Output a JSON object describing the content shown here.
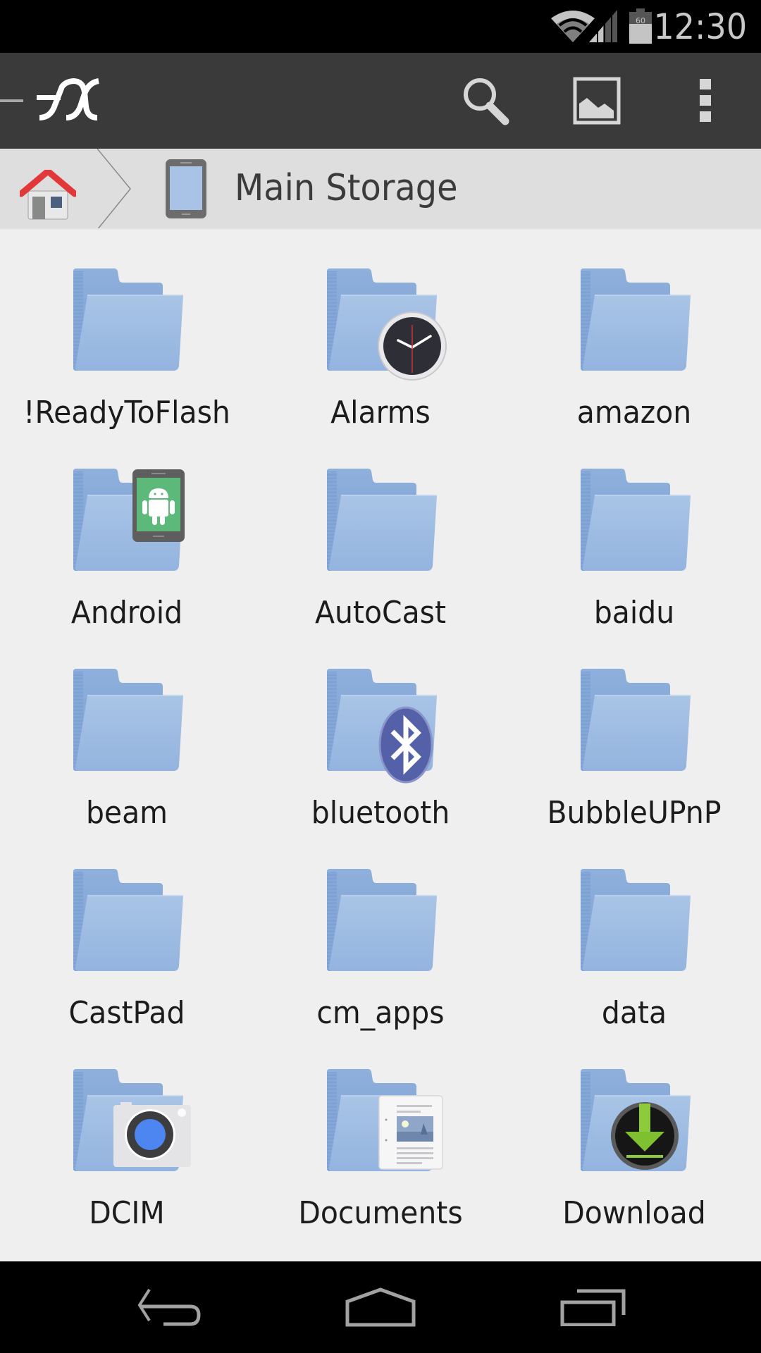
{
  "status_bar": {
    "time": "12:30",
    "battery_level": "60",
    "icons": [
      "wifi-icon",
      "cell-signal-icon",
      "battery-icon"
    ]
  },
  "toolbar": {
    "app_logo": "FX",
    "actions": [
      {
        "name": "search",
        "icon": "search-icon"
      },
      {
        "name": "thumbnails",
        "icon": "image-icon"
      },
      {
        "name": "more",
        "icon": "overflow-menu-icon"
      }
    ]
  },
  "breadcrumb": {
    "home_icon": "home-icon",
    "current": {
      "label": "Main Storage",
      "icon": "phone-storage-icon"
    }
  },
  "colors": {
    "toolbar_bg": "#3a3a3a",
    "breadcrumb_bg": "#dedede",
    "content_bg": "#efefef",
    "folder_blue": "#9bbbe2"
  },
  "folders": [
    {
      "name": "!ReadyToFlash",
      "badge": null
    },
    {
      "name": "Alarms",
      "badge": "clock-icon"
    },
    {
      "name": "amazon",
      "badge": null
    },
    {
      "name": "Android",
      "badge": "android-device-icon"
    },
    {
      "name": "AutoCast",
      "badge": null
    },
    {
      "name": "baidu",
      "badge": null
    },
    {
      "name": "beam",
      "badge": null
    },
    {
      "name": "bluetooth",
      "badge": "bluetooth-icon"
    },
    {
      "name": "BubbleUPnP",
      "badge": null
    },
    {
      "name": "CastPad",
      "badge": null
    },
    {
      "name": "cm_apps",
      "badge": null
    },
    {
      "name": "data",
      "badge": null
    },
    {
      "name": "DCIM",
      "badge": "camera-icon"
    },
    {
      "name": "Documents",
      "badge": "document-icon"
    },
    {
      "name": "Download",
      "badge": "download-icon"
    }
  ],
  "nav_bar": {
    "buttons": [
      "back",
      "home",
      "recents"
    ]
  }
}
